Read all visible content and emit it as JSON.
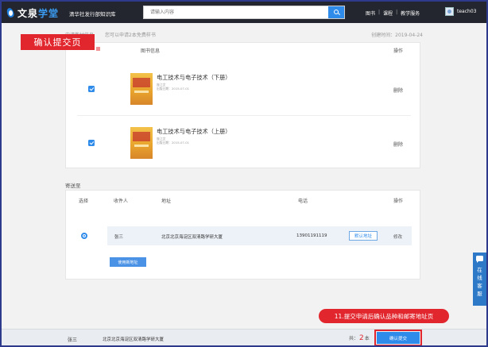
{
  "header": {
    "logo_text_a": "文泉",
    "logo_text_b": "学堂",
    "site_name": "清华社发行部知识库",
    "search_placeholder": "请输入内容",
    "nav": [
      "图书",
      "课程",
      "教学服务"
    ],
    "nav_sep": "|",
    "username": "teach03"
  },
  "overlay": {
    "page_label": "确认提交页",
    "annotation": "11.提交申请后确认品种和邮寄地址页"
  },
  "books_section": {
    "apply_label": "申请教材信息",
    "hint": "您可以申请2本免费样书",
    "created_date": "创建时间：2019-04-24",
    "col_info": "图书信息",
    "col_op": "操作",
    "items": [
      {
        "title": "电工技术与电子技术（下册）",
        "author": "庞江文",
        "pubdate": "出版日期：2015-07-01",
        "action": "删除",
        "checked": true
      },
      {
        "title": "电工技术与电子技术（上册）",
        "author": "庞江文",
        "pubdate": "出版日期：2015-07-01",
        "action": "删除",
        "checked": true
      }
    ]
  },
  "address_section": {
    "label": "寄送至",
    "columns": [
      "选择",
      "收件人",
      "地址",
      "电话",
      "操作"
    ],
    "row": {
      "selected": true,
      "recipient": "张三",
      "address": "北京北京海淀区双清路学研大厦",
      "phone": "13901191119",
      "default_label": "默认地址",
      "edit_label": "修改"
    },
    "new_address_label": "使用新地址"
  },
  "side_widget": {
    "chars": [
      "在",
      "线",
      "客",
      "服"
    ]
  },
  "footer": {
    "name": "张三",
    "address": "北京北京海淀区双清路学研大厦",
    "total_prefix": "共：",
    "total_count": "2",
    "total_suffix": "本",
    "confirm_label": "确认提交"
  },
  "colors": {
    "accent": "#2e8bea",
    "annotation_red": "#e2262d",
    "topbar": "#23262e"
  }
}
